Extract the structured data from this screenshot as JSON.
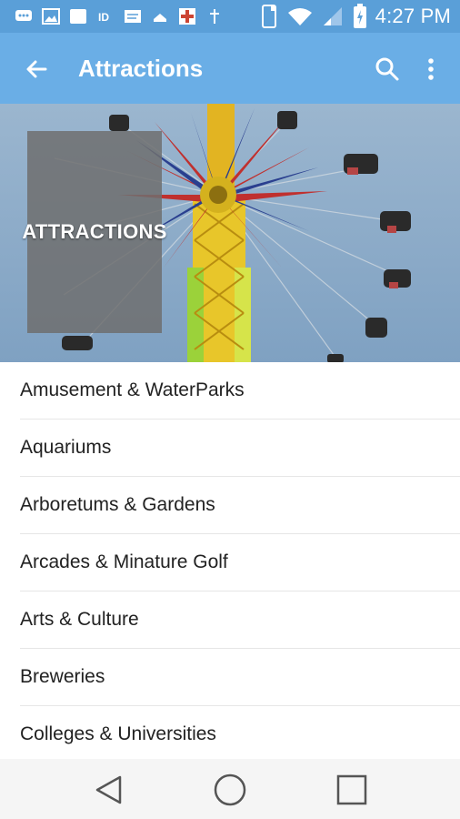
{
  "status_bar": {
    "time": "4:27 PM",
    "icons": [
      "message-icon",
      "image-icon",
      "app-icon",
      "id-icon",
      "note-icon",
      "dropbox-icon",
      "cross-icon",
      "dagger-icon",
      "phone-icon",
      "wifi-icon",
      "signal-icon",
      "battery-icon"
    ]
  },
  "app_bar": {
    "title": "Attractions"
  },
  "hero": {
    "overlay_title": "ATTRACTIONS"
  },
  "categories": [
    "Amusement & WaterParks",
    "Aquariums",
    "Arboretums & Gardens",
    "Arcades & Minature Golf",
    "Arts & Culture",
    "Breweries",
    "Colleges & Universities"
  ],
  "colors": {
    "status_bar": "#5a9fd8",
    "app_bar": "#6aaee6",
    "divider": "#e6e6e6"
  }
}
